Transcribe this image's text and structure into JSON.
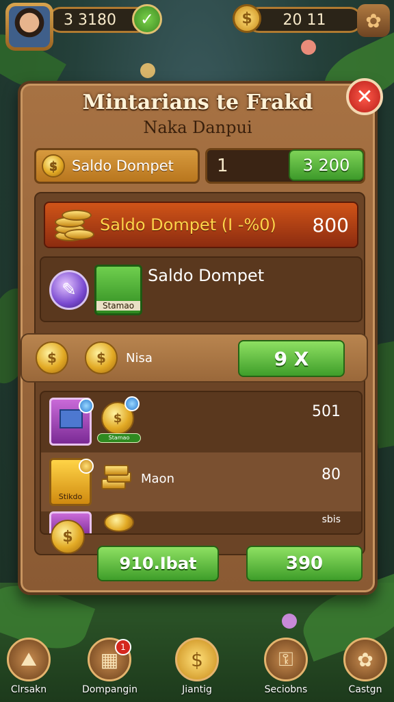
{
  "hud": {
    "player_balance": "3 3180",
    "coins": "20 11"
  },
  "panel": {
    "title": "Mintarians te Frakd",
    "subtitle": "Naka Danpui",
    "balance_label": "Saldo Dompet",
    "amount_value": "1",
    "amount_button": "3 200",
    "red_label": "Saldo Dompet (I -%0)",
    "red_value": "800",
    "wallet_item_label": "Stamao",
    "wallet_text": "Saldo Dompet",
    "nisa_text": "Nisa",
    "nisa_button": "9 X",
    "list": [
      {
        "label": "Stamao",
        "value": "501"
      },
      {
        "label": "Maon",
        "card_label": "Stikdo",
        "value": "80"
      },
      {
        "label": "",
        "value": "sbis"
      }
    ],
    "button_left": "910.Ibat",
    "button_right": "390"
  },
  "nav": [
    {
      "label": "Clrsakn",
      "icon": "map-icon"
    },
    {
      "label": "Dompangin",
      "icon": "chest-icon",
      "badge": "1"
    },
    {
      "label": "Jiantig",
      "icon": "coin-icon"
    },
    {
      "label": "Seciobns",
      "icon": "gold-key-icon"
    },
    {
      "label": "Castgn",
      "icon": "puzzle-icon"
    }
  ]
}
